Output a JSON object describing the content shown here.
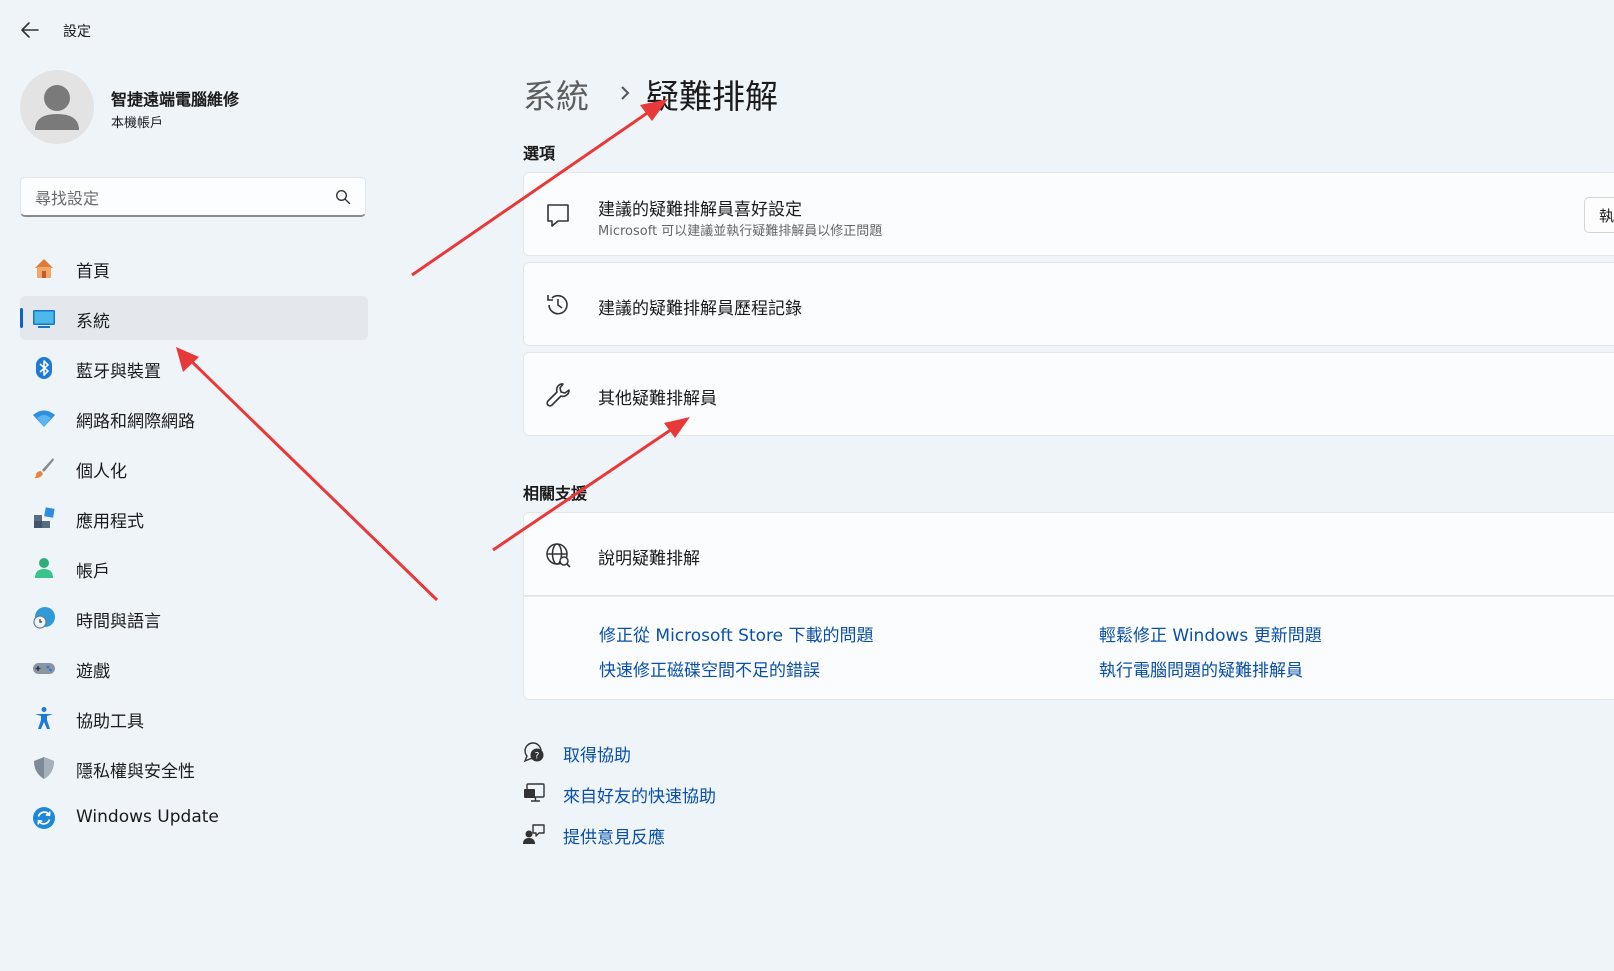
{
  "app": {
    "title": "設定",
    "back_icon": "arrow-left-icon"
  },
  "profile": {
    "name": "智捷遠端電腦維修",
    "account_type": "本機帳戶"
  },
  "search": {
    "placeholder": "尋找設定",
    "icon": "search-icon"
  },
  "sidebar": {
    "items": [
      {
        "label": "首頁",
        "icon": "home-icon",
        "active": false
      },
      {
        "label": "系統",
        "icon": "monitor-icon",
        "active": true
      },
      {
        "label": "藍牙與裝置",
        "icon": "bluetooth-icon",
        "active": false
      },
      {
        "label": "網路和網際網路",
        "icon": "wifi-icon",
        "active": false
      },
      {
        "label": "個人化",
        "icon": "paintbrush-icon",
        "active": false
      },
      {
        "label": "應用程式",
        "icon": "apps-icon",
        "active": false
      },
      {
        "label": "帳戶",
        "icon": "person-icon",
        "active": false
      },
      {
        "label": "時間與語言",
        "icon": "globe-clock-icon",
        "active": false
      },
      {
        "label": "遊戲",
        "icon": "gamepad-icon",
        "active": false
      },
      {
        "label": "協助工具",
        "icon": "accessibility-icon",
        "active": false
      },
      {
        "label": "隱私權與安全性",
        "icon": "shield-icon",
        "active": false
      },
      {
        "label": "Windows Update",
        "icon": "windows-update-icon",
        "active": false
      }
    ]
  },
  "breadcrumb": {
    "parent": "系統",
    "current": "疑難排解"
  },
  "options": {
    "heading": "選項",
    "cards": [
      {
        "title": "建議的疑難排解員喜好設定",
        "subtitle": "Microsoft 可以建議並執行疑難排解員以修正問題",
        "icon": "chat-bubble-icon",
        "button": "執"
      },
      {
        "title": "建議的疑難排解員歷程記錄",
        "icon": "history-icon"
      },
      {
        "title": "其他疑難排解員",
        "icon": "wrench-icon"
      }
    ]
  },
  "support": {
    "heading": "相關支援",
    "card_title": "說明疑難排解",
    "card_icon": "globe-search-icon",
    "links": [
      "修正從 Microsoft Store 下載的問題",
      "輕鬆修正 Windows 更新問題",
      "快速修正磁碟空間不足的錯誤",
      "執行電腦問題的疑難排解員"
    ]
  },
  "footer_links": [
    {
      "label": "取得協助",
      "icon": "help-chat-icon"
    },
    {
      "label": "來自好友的快速協助",
      "icon": "remote-assist-icon"
    },
    {
      "label": "提供意見反應",
      "icon": "feedback-icon"
    }
  ],
  "colors": {
    "accent": "#0f63c8",
    "link": "#0a4fa8",
    "annotation_arrow": "#e8393a",
    "background": "#eff4f9"
  }
}
